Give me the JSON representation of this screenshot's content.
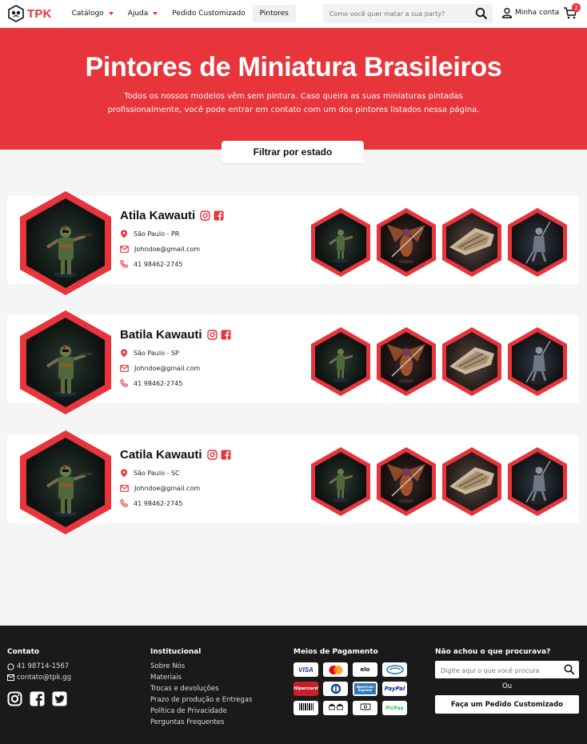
{
  "header": {
    "logo_text": "TPK",
    "nav": [
      {
        "label": "Catálogo",
        "has_caret": true
      },
      {
        "label": "Ajuda",
        "has_caret": true
      },
      {
        "label": "Pedido Customizado",
        "has_caret": false
      },
      {
        "label": "Pintores",
        "has_caret": false,
        "active": true
      }
    ],
    "search_placeholder": "Como você quer matar a sua party?",
    "account_label": "Minha conta",
    "cart_count": "2"
  },
  "hero": {
    "title": "Pintores de Miniatura Brasileiros",
    "subtitle_line1": "Todos os nossos modelos vêm sem pintura. Caso queira as suas miniaturas pintadas",
    "subtitle_line2": "profissionalmente, você pode entrar em contato com um dos pintores listados nessa página.",
    "filter_label": "Filtrar por estado"
  },
  "painters": [
    {
      "name": "Atila Kawauti",
      "location": "São Paulo - PR",
      "email": "Johndoe@gmail.com",
      "phone": "41 98462-2745"
    },
    {
      "name": "Batila Kawauti",
      "location": "São Paulo - SP",
      "email": "Johndoe@gmail.com",
      "phone": "41 98462-2745"
    },
    {
      "name": "Catila Kawauti",
      "location": "São Paulo - SC",
      "email": "Johndoe@gmail.com",
      "phone": "41 98462-2745"
    }
  ],
  "footer": {
    "contact": {
      "heading": "Contato",
      "phone": "41 98714-1567",
      "email": "contato@tpk.gg"
    },
    "institutional": {
      "heading": "Institucional",
      "links": [
        "Sobre Nós",
        "Materiais",
        "Trocas e devoluções",
        "Prazo de produção e Entregas",
        "Política de Privacidade",
        "Perguntas Frequentes"
      ]
    },
    "payment": {
      "heading": "Meios de Pagamento",
      "methods": [
        "VISA",
        "Mastercard",
        "elo",
        "Cartão",
        "Hipercard",
        "Diners",
        "American Express",
        "PayPal",
        "BOLETO",
        "DEPÓSITO",
        "DINHEIRO",
        "PicPay"
      ]
    },
    "not_found": {
      "heading": "Não achou o que procurava?",
      "search_placeholder": "Digite aqui o que você procura",
      "or_label": "Ou",
      "custom_order_label": "Faça um Pedido Customizado"
    }
  },
  "colors": {
    "brand": "#e8343b",
    "footer_bg": "#1a1a1a"
  }
}
